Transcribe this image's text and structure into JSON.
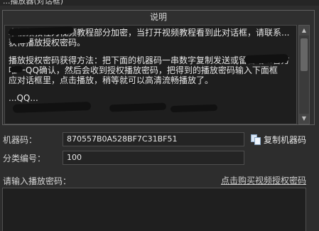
{
  "window": {
    "title_fragment": "...播放器(对话框)"
  },
  "info_group": {
    "caption": "说明",
    "paragraphs": [
      "本视频教程为视频教程部分加密，当打开视频教程看到此对话框，请联系...获得播放授权密码。",
      "播放授权密码获得方法：把下面的机器码一串数字复制发送或留言给...官方唯一QQ确认，然后会收到授权播放密码，把得到的播放密码输入下面框",
      "应对话框里，点击播放，稍等就可以高清流畅播放了。",
      "...QQ..."
    ]
  },
  "fields": {
    "machine_code_label": "机器码：",
    "machine_code_value": "870557B0A528BF7C31BF51",
    "copy_button_label": "复制机器码",
    "category_label": "分类编号：",
    "category_value": "100"
  },
  "password": {
    "label": "请输入播放密码：",
    "buy_link": "点击购买视频授权密码",
    "value": ""
  }
}
